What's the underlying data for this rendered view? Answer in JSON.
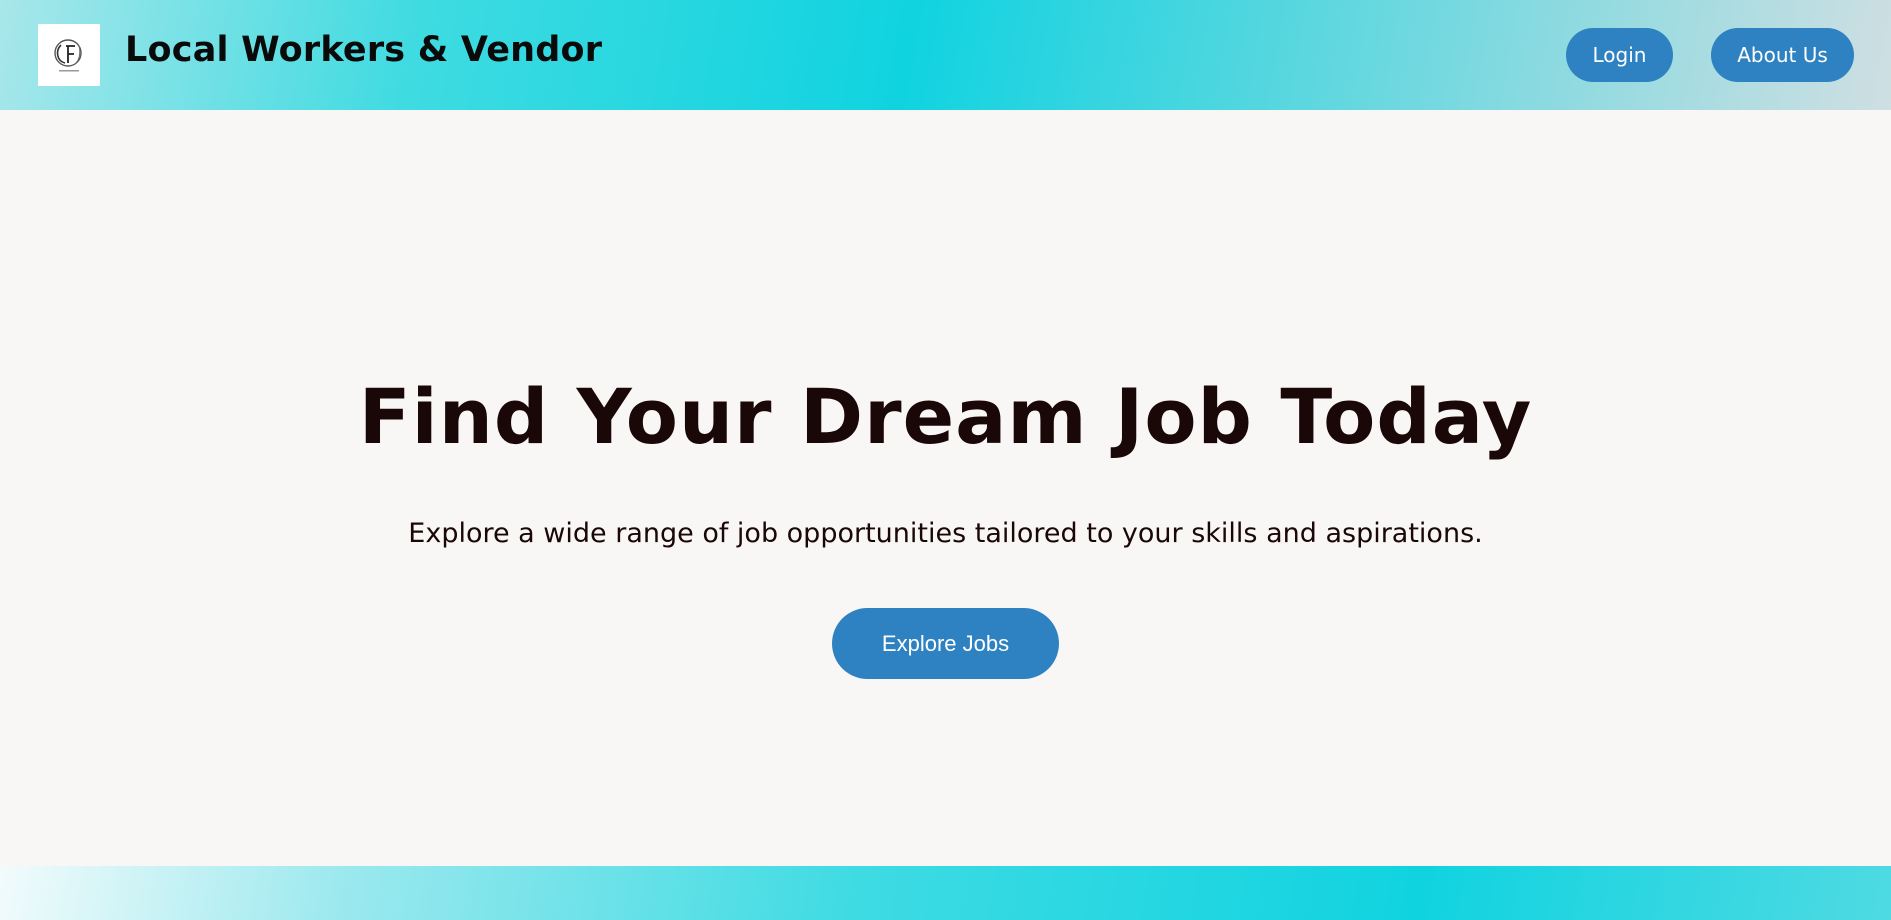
{
  "header": {
    "logo_icon": "company-logo-icon",
    "title": "Local Workers & Vendor",
    "nav": {
      "login_label": "Login",
      "about_label": "About Us"
    }
  },
  "hero": {
    "title": "Find Your Dream Job Today",
    "subtitle": "Explore a wide range of job opportunities tailored to your skills and aspirations.",
    "cta_label": "Explore Jobs"
  },
  "colors": {
    "accent_button": "#2e82c2",
    "header_gradient_mid": "#10d3e0",
    "page_background": "#f9f7f6",
    "heading_text": "#1a0707"
  }
}
